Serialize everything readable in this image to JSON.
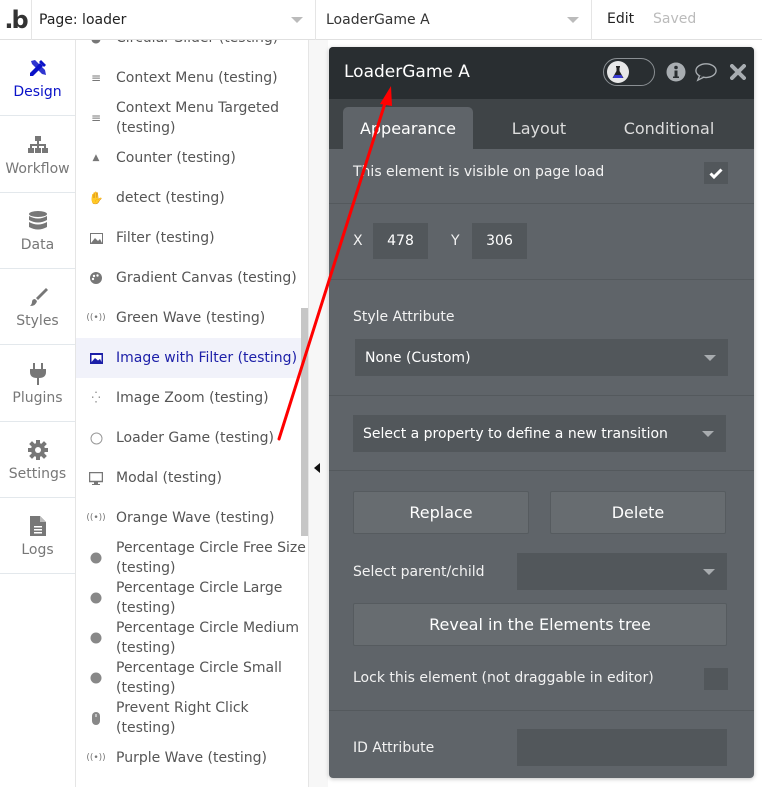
{
  "topbar": {
    "logo": ".b",
    "page_selector": "Page: loader",
    "element_selector": "LoaderGame A",
    "edit_label": "Edit",
    "saved_label": "Saved"
  },
  "leftnav": {
    "items": [
      {
        "label": "Design",
        "icon": "design-icon",
        "active": true
      },
      {
        "label": "Workflow",
        "icon": "workflow-icon"
      },
      {
        "label": "Data",
        "icon": "database-icon"
      },
      {
        "label": "Styles",
        "icon": "brush-icon"
      },
      {
        "label": "Plugins",
        "icon": "plug-icon"
      },
      {
        "label": "Settings",
        "icon": "gear-icon"
      },
      {
        "label": "Logs",
        "icon": "file-icon"
      }
    ]
  },
  "element_list": {
    "items": [
      {
        "label": "Circular Slider (testing)",
        "icon": "circle-slider-icon"
      },
      {
        "label": "Context Menu (testing)",
        "icon": "menu-icon"
      },
      {
        "label": "Context Menu Targeted (testing)",
        "icon": "menu-icon"
      },
      {
        "label": "Counter (testing)",
        "icon": "triangle-icon"
      },
      {
        "label": "detect (testing)",
        "icon": "hand-icon"
      },
      {
        "label": "Filter (testing)",
        "icon": "image-icon"
      },
      {
        "label": "Gradient Canvas (testing)",
        "icon": "palette-icon"
      },
      {
        "label": "Green Wave (testing)",
        "icon": "broadcast-icon"
      },
      {
        "label": "Image with Filter (testing)",
        "icon": "image-folder-icon",
        "selected": true
      },
      {
        "label": "Image Zoom (testing)",
        "icon": "compress-icon"
      },
      {
        "label": "Loader Game (testing)",
        "icon": "circle-outline-icon"
      },
      {
        "label": "Modal (testing)",
        "icon": "monitor-icon"
      },
      {
        "label": "Orange Wave (testing)",
        "icon": "broadcast-icon"
      },
      {
        "label": "Percentage Circle Free Size (testing)",
        "icon": "circle-filled-icon"
      },
      {
        "label": "Percentage Circle Large (testing)",
        "icon": "circle-filled-icon"
      },
      {
        "label": "Percentage Circle Medium (testing)",
        "icon": "circle-filled-icon"
      },
      {
        "label": "Percentage Circle Small (testing)",
        "icon": "circle-filled-icon"
      },
      {
        "label": "Prevent Right Click (testing)",
        "icon": "mouse-icon"
      },
      {
        "label": "Purple Wave (testing)",
        "icon": "broadcast-icon"
      }
    ]
  },
  "editor": {
    "title": "LoaderGame A",
    "tabs": [
      {
        "label": "Appearance",
        "active": true
      },
      {
        "label": "Layout"
      },
      {
        "label": "Conditional"
      }
    ],
    "visible_on_load_label": "This element is visible on page load",
    "visible_on_load": true,
    "x_label": "X",
    "x_value": "478",
    "y_label": "Y",
    "y_value": "306",
    "style_attribute_label": "Style Attribute",
    "style_attribute_value": "None (Custom)",
    "transition_placeholder": "Select a property to define a new transition",
    "replace_label": "Replace",
    "delete_label": "Delete",
    "select_parent_child_label": "Select parent/child",
    "select_parent_child_value": "",
    "reveal_label": "Reveal in the Elements tree",
    "lock_label": "Lock this element (not draggable in editor)",
    "lock_checked": false,
    "id_attribute_label": "ID Attribute",
    "id_attribute_value": ""
  },
  "colors": {
    "accent": "#0a12c8",
    "annotation_arrow": "#ff0000",
    "editor_bg": "#5f6469",
    "editor_header": "#292e31"
  }
}
